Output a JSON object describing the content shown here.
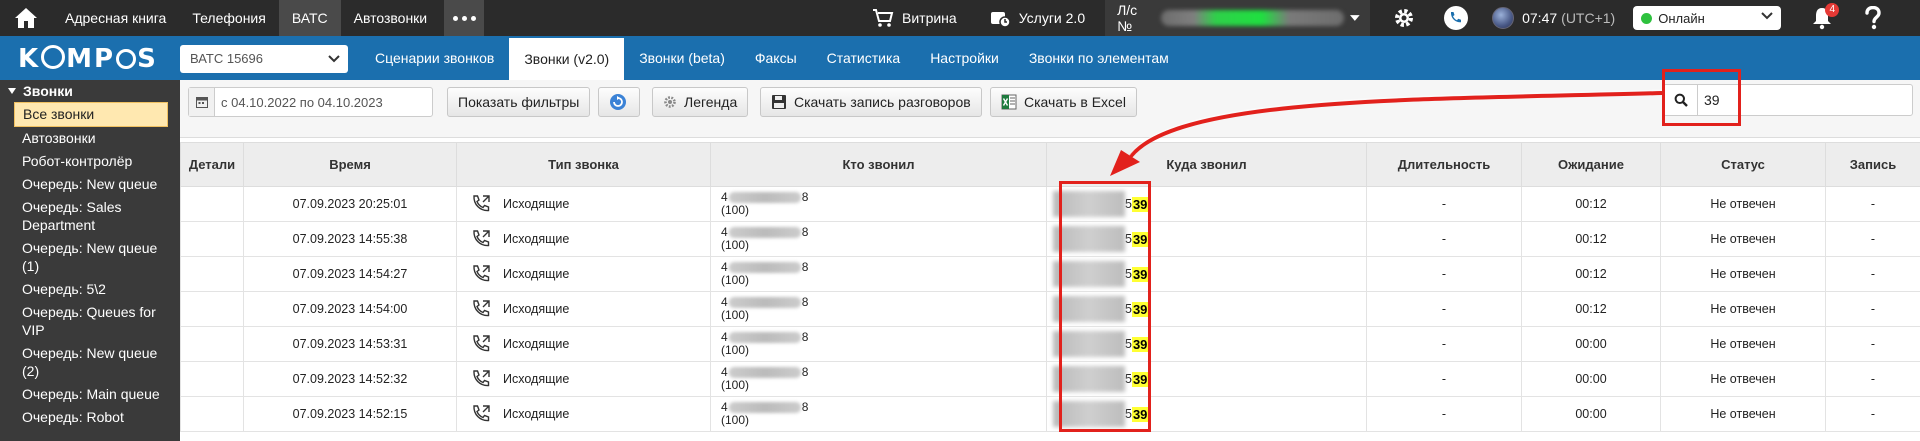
{
  "topbar": {
    "menu": [
      "Адресная книга",
      "Телефония",
      "ВАТС",
      "Автозвонки"
    ],
    "active_menu": "ВАТС",
    "vitrina": "Витрина",
    "services": "Услуги 2.0",
    "account_label": "Л/с №",
    "time": "07:47",
    "timezone": "(UTC+1)",
    "status": "Онлайн",
    "notifications": "4"
  },
  "brand": {
    "logo_left": "K",
    "logo_mid": "MP",
    "logo_right": "S"
  },
  "bluebar": {
    "vats_select": "ВАТС 15696",
    "tabs": [
      "Сценарии звонков",
      "Звонки (v2.0)",
      "Звонки (beta)",
      "Факсы",
      "Статистика",
      "Настройки",
      "Звонки по элементам"
    ],
    "active_tab": "Звонки (v2.0)"
  },
  "sidebar": {
    "header": "Звонки",
    "items": [
      "Все звонки",
      "Автозвонки",
      "Робот-контролёр",
      "Очередь: New queue",
      "Очередь: Sales Department",
      "Очередь: New queue (1)",
      "Очередь: 5\\2",
      "Очередь: Queues for VIP",
      "Очередь: New queue (2)",
      "Очередь: Main queue",
      "Очередь: Robot"
    ],
    "active_item": "Все звонки"
  },
  "toolbar": {
    "date_range": "с 04.10.2022 по 04.10.2023",
    "show_filters": "Показать фильтры",
    "legend": "Легенда",
    "download_records": "Скачать запись разговоров",
    "download_excel": "Скачать в Excel",
    "search_value": "39"
  },
  "table": {
    "headers": [
      "Детали",
      "Время",
      "Тип звонка",
      "Кто звонил",
      "Куда звонил",
      "Длительность",
      "Ожидание",
      "Статус",
      "Запись"
    ],
    "rows": [
      {
        "time": "07.09.2023 20:25:01",
        "type": "Исходящие",
        "caller_prefix": "4",
        "caller_suffix": "8",
        "caller_ext": "(100)",
        "dest_prefix": "5",
        "dest_match": "39",
        "duration": "-",
        "wait": "00:12",
        "status": "Не отвечен",
        "record": "-"
      },
      {
        "time": "07.09.2023 14:55:38",
        "type": "Исходящие",
        "caller_prefix": "4",
        "caller_suffix": "8",
        "caller_ext": "(100)",
        "dest_prefix": "5",
        "dest_match": "39",
        "duration": "-",
        "wait": "00:12",
        "status": "Не отвечен",
        "record": "-"
      },
      {
        "time": "07.09.2023 14:54:27",
        "type": "Исходящие",
        "caller_prefix": "4",
        "caller_suffix": "8",
        "caller_ext": "(100)",
        "dest_prefix": "5",
        "dest_match": "39",
        "duration": "-",
        "wait": "00:12",
        "status": "Не отвечен",
        "record": "-"
      },
      {
        "time": "07.09.2023 14:54:00",
        "type": "Исходящие",
        "caller_prefix": "4",
        "caller_suffix": "8",
        "caller_ext": "(100)",
        "dest_prefix": "5",
        "dest_match": "39",
        "duration": "-",
        "wait": "00:12",
        "status": "Не отвечен",
        "record": "-"
      },
      {
        "time": "07.09.2023 14:53:31",
        "type": "Исходящие",
        "caller_prefix": "4",
        "caller_suffix": "8",
        "caller_ext": "(100)",
        "dest_prefix": "5",
        "dest_match": "39",
        "duration": "-",
        "wait": "00:00",
        "status": "Не отвечен",
        "record": "-"
      },
      {
        "time": "07.09.2023 14:52:32",
        "type": "Исходящие",
        "caller_prefix": "4",
        "caller_suffix": "8",
        "caller_ext": "(100)",
        "dest_prefix": "5",
        "dest_match": "39",
        "duration": "-",
        "wait": "00:00",
        "status": "Не отвечен",
        "record": "-"
      },
      {
        "time": "07.09.2023 14:52:15",
        "type": "Исходящие",
        "caller_prefix": "4",
        "caller_suffix": "8",
        "caller_ext": "(100)",
        "dest_prefix": "5",
        "dest_match": "39",
        "duration": "-",
        "wait": "00:00",
        "status": "Не отвечен",
        "record": "-"
      }
    ]
  },
  "colors": {
    "topbar": "#2b2b2b",
    "brand_blue": "#1b6fae",
    "highlight": "#ffff33",
    "annotation_red": "#e2211c",
    "online_green": "#2ec13e"
  }
}
